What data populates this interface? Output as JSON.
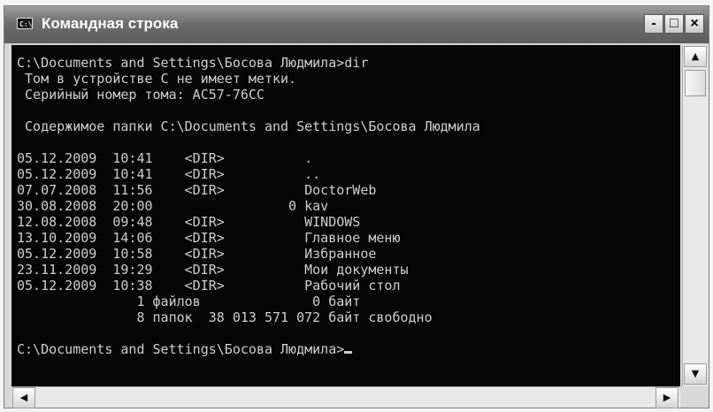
{
  "window": {
    "icon_text": "C:\\",
    "title": "Командная строка",
    "minimize_label": "-",
    "maximize_label": "□",
    "close_label": "×"
  },
  "console": {
    "lines": [
      "C:\\Documents and Settings\\Босова Людмила>dir",
      " Том в устройстве C не имеет метки.",
      " Серийный номер тома: AC57-76CC",
      "",
      " Содержимое папки C:\\Documents and Settings\\Босова Людмила",
      "",
      "05.12.2009  10:41    <DIR>          .",
      "05.12.2009  10:41    <DIR>          ..",
      "07.07.2008  11:56    <DIR>          DoctorWeb",
      "30.08.2008  20:00                 0 kav",
      "12.08.2008  09:48    <DIR>          WINDOWS",
      "13.10.2009  14:06    <DIR>          Главное меню",
      "05.12.2009  10:58    <DIR>          Избранное",
      "23.11.2009  19:29    <DIR>          Мои документы",
      "05.12.2009  10:38    <DIR>          Рабочий стол",
      "               1 файлов              0 байт",
      "               8 папок  38 013 571 072 байт свободно",
      "",
      "C:\\Documents and Settings\\Босова Людмила>"
    ]
  },
  "scrollbar": {
    "up": "▲",
    "down": "▼",
    "left": "◀",
    "right": "▶"
  }
}
